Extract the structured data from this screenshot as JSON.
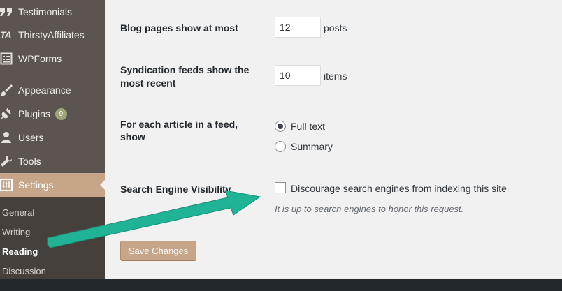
{
  "sidebar": {
    "items": [
      {
        "label": "Testimonials",
        "icon": "quote-icon"
      },
      {
        "label": "ThirstyAffiliates",
        "icon": "ta-logo-icon"
      },
      {
        "label": "WPForms",
        "icon": "form-icon"
      },
      {
        "label": "Appearance",
        "icon": "paintbrush-icon"
      },
      {
        "label": "Plugins",
        "icon": "plug-icon",
        "badge": "9"
      },
      {
        "label": "Users",
        "icon": "user-icon"
      },
      {
        "label": "Tools",
        "icon": "wrench-icon"
      },
      {
        "label": "Settings",
        "icon": "settings-icon",
        "active": true
      }
    ],
    "submenu": [
      "General",
      "Writing",
      "Reading",
      "Discussion"
    ],
    "current_submenu": "Reading"
  },
  "form": {
    "blog_pages": {
      "label": "Blog pages show at most",
      "value": "12",
      "unit": "posts"
    },
    "syndication": {
      "label_line1": "Syndication feeds show the",
      "label_line2": "most recent",
      "value": "10",
      "unit": "items"
    },
    "feed_article": {
      "label_line1": "For each article in a feed,",
      "label_line2": "show",
      "options": [
        "Full text",
        "Summary"
      ],
      "selected": "Full text"
    },
    "search_visibility": {
      "label": "Search Engine Visibility",
      "checkbox_label": "Discourage search engines from indexing this site",
      "checked": false,
      "description": "It is up to search engines to honor this request."
    }
  },
  "save_button": "Save Changes",
  "colors": {
    "sidebar_bg": "#5c5450",
    "submenu_bg": "#46403c",
    "accent": "#c7a589",
    "badge": "#9ea476",
    "arrow": "#21b395",
    "content_bg": "#f1f1f1"
  }
}
